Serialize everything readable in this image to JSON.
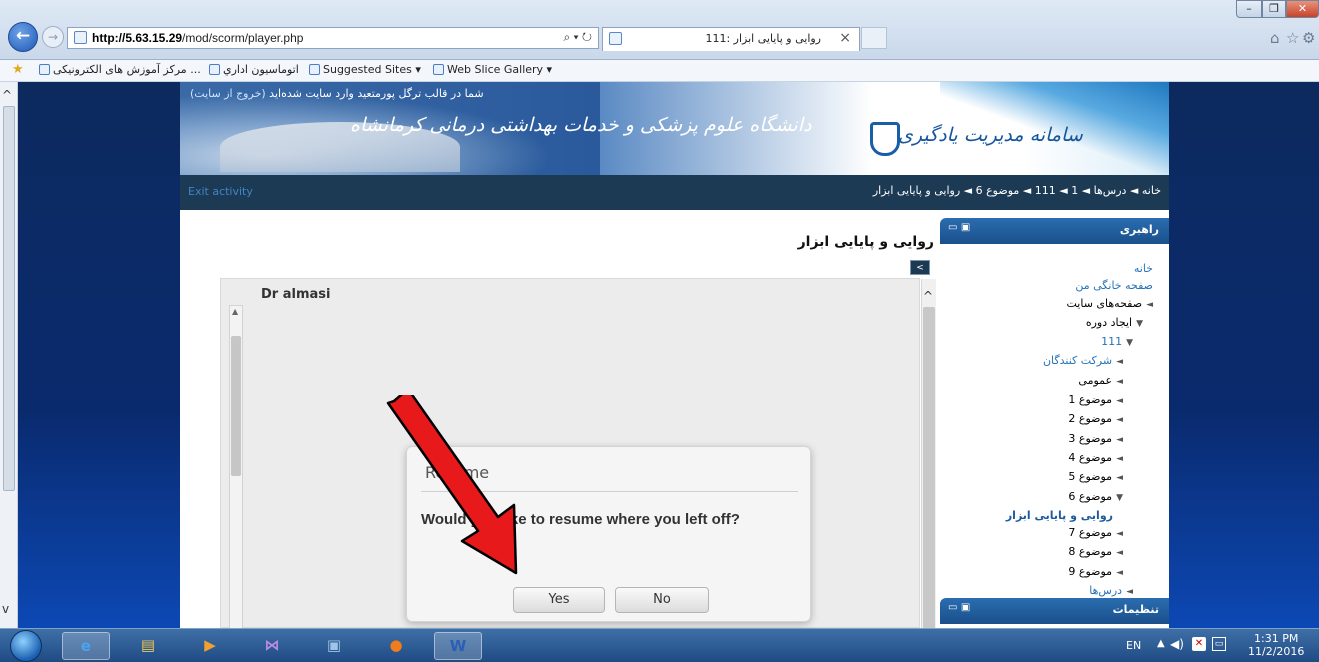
{
  "browser": {
    "url_host": "http://5.63.15.29",
    "url_path": "/mod/scorm/player.php",
    "address_tools": "⌕ ▾ ↻",
    "tab_title": "روایی و پایایی ابزار :111",
    "tab_close": "×",
    "favorites": [
      {
        "label": "مرکز آموزش های الکترونیکی ..."
      },
      {
        "label": "اتوماسیون اداري"
      },
      {
        "label": "Suggested Sites ▾"
      },
      {
        "label": "Web Slice Gallery ▾"
      }
    ]
  },
  "site": {
    "login_text": "شما در قالب ترگل پورمتعید وارد سایت شده‌اید",
    "logout_link": "(خروج از سایت)",
    "university_name": "دانشگاه علوم پزشکی و خدمات بهداشتی درمانی کرمانشاه",
    "lms_name": "سامانه مدیریت یادگیری",
    "exit_activity": "Exit activity",
    "breadcrumb": "خانه ◄ درس‌ها ◄ 1 ◄ 111 ◄ موضوع 6 ◄ روایی و پایایی ابزار"
  },
  "content": {
    "page_title": "روایی و پایایی ابزار",
    "collapse_label": "<",
    "player_title": "Dr almasi"
  },
  "dialog": {
    "title": "Resume",
    "message": "Would you like to resume where you left off?",
    "yes_label": "Yes",
    "no_label": "No"
  },
  "sidebar": {
    "guide_title": "راهبری",
    "settings_title": "تنظیمات",
    "tree": [
      {
        "label": "خانه",
        "style": "link",
        "indent": 0,
        "caret": ""
      },
      {
        "label": "صفحه خانگی من",
        "style": "link",
        "indent": 0,
        "caret": ""
      },
      {
        "label": "صفحه‌های سایت",
        "style": "text",
        "indent": 0,
        "caret": "◄"
      },
      {
        "label": "ایجاد دوره",
        "style": "text",
        "indent": 1,
        "caret": "▼"
      },
      {
        "label": "111",
        "style": "link",
        "indent": 2,
        "caret": "▼"
      },
      {
        "label": "شرکت کنندگان",
        "style": "link",
        "indent": 3,
        "caret": "◄"
      },
      {
        "label": "عمومی",
        "style": "text",
        "indent": 3,
        "caret": "◄"
      },
      {
        "label": "موضوع 1",
        "style": "text",
        "indent": 3,
        "caret": "◄"
      },
      {
        "label": "موضوع 2",
        "style": "text",
        "indent": 3,
        "caret": "◄"
      },
      {
        "label": "موضوع 3",
        "style": "text",
        "indent": 3,
        "caret": "◄"
      },
      {
        "label": "موضوع 4",
        "style": "text",
        "indent": 3,
        "caret": "◄"
      },
      {
        "label": "موضوع 5",
        "style": "text",
        "indent": 3,
        "caret": "◄"
      },
      {
        "label": "موضوع 6",
        "style": "text",
        "indent": 3,
        "caret": "▼"
      },
      {
        "label": "روایی و پایایی ابزار",
        "style": "bold",
        "indent": 4,
        "caret": ""
      },
      {
        "label": "موضوع 7",
        "style": "text",
        "indent": 3,
        "caret": "◄"
      },
      {
        "label": "موضوع 8",
        "style": "text",
        "indent": 3,
        "caret": "◄"
      },
      {
        "label": "موضوع 9",
        "style": "text",
        "indent": 3,
        "caret": "◄"
      },
      {
        "label": "درس‌ها",
        "style": "link",
        "indent": 2,
        "caret": "◄"
      }
    ]
  },
  "taskbar": {
    "apps": [
      {
        "name": "internet-explorer",
        "glyph": "e",
        "active": true,
        "color": "#4aa3f0"
      },
      {
        "name": "file-explorer",
        "glyph": "▤",
        "active": false,
        "color": "#f2c84b"
      },
      {
        "name": "media-player",
        "glyph": "▶",
        "active": false,
        "color": "#f0a030"
      },
      {
        "name": "bowtie-app",
        "glyph": "⋈",
        "active": false,
        "color": "#b98ce0"
      },
      {
        "name": "kmplayer",
        "glyph": "▣",
        "active": false,
        "color": "#9fc4e8"
      },
      {
        "name": "firefox",
        "glyph": "●",
        "active": false,
        "color": "#f07c1e"
      },
      {
        "name": "word",
        "glyph": "W",
        "active": true,
        "color": "#2b5fb4"
      }
    ],
    "lang": "EN",
    "time": "1:31 PM",
    "date": "11/2/2016"
  },
  "colors": {
    "annotation_arrow": "#e8191a"
  }
}
